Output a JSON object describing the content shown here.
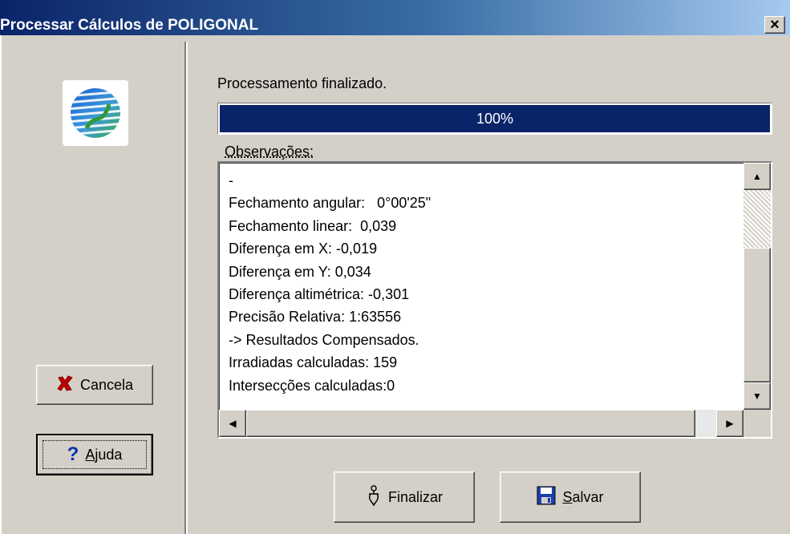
{
  "window": {
    "title": "Processar Cálculos de POLIGONAL",
    "close_label": "×"
  },
  "status_text": "Processamento finalizado.",
  "progress": {
    "value": 1.0,
    "label": "100%"
  },
  "observations": {
    "label": "Observações:",
    "lines": [
      "-",
      "Fechamento angular:   0°00'25\"",
      "Fechamento linear:  0,039",
      "Diferença em X: -0,019",
      "Diferença em Y: 0,034",
      "Diferença altimétrica: -0,301",
      "Precisão Relativa: 1:63556",
      "-> Resultados Compensados.",
      "Irradiadas calculadas: 159",
      "Intersecções calculadas:0"
    ]
  },
  "buttons": {
    "cancel_label": "Cancela",
    "help_label": "Ajuda",
    "finish_label": "Finalizar",
    "save_label": "Salvar"
  },
  "icons": {
    "cancel": "red-x-icon",
    "help": "question-mark-icon",
    "finish": "finish-icon",
    "save": "floppy-disk-icon",
    "logo": "globe-logo-icon"
  },
  "colors": {
    "titlebar": "#0a246a",
    "progress": "#0a246a",
    "face": "#d4d0c8"
  }
}
